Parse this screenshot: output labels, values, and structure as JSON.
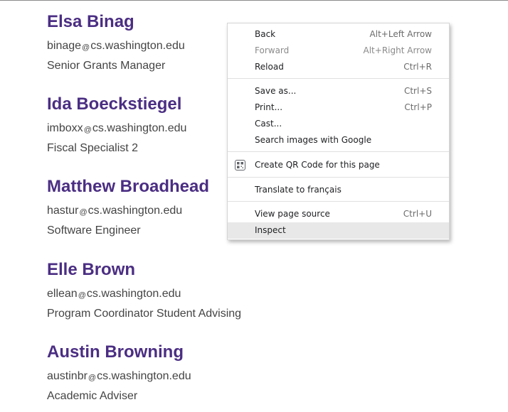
{
  "people": [
    {
      "name": "Elsa Binag",
      "email_user": "binage",
      "at": "@",
      "email_domain": "cs.washington.edu",
      "role": "Senior Grants Manager"
    },
    {
      "name": "Ida Boeckstiegel",
      "email_user": "imboxx",
      "at": "@",
      "email_domain": "cs.washington.edu",
      "role": "Fiscal Specialist 2"
    },
    {
      "name": "Matthew Broadhead",
      "email_user": "hastur",
      "at": "@",
      "email_domain": "cs.washington.edu",
      "role": "Software Engineer"
    },
    {
      "name": "Elle Brown",
      "email_user": "ellean",
      "at": "@",
      "email_domain": "cs.washington.edu",
      "role": "Program Coordinator Student Advising"
    },
    {
      "name": "Austin Browning",
      "email_user": "austinbr",
      "at": "@",
      "email_domain": "cs.washington.edu",
      "role": "Academic Adviser"
    }
  ],
  "context_menu": {
    "back": {
      "label": "Back",
      "shortcut": "Alt+Left Arrow"
    },
    "forward": {
      "label": "Forward",
      "shortcut": "Alt+Right Arrow"
    },
    "reload": {
      "label": "Reload",
      "shortcut": "Ctrl+R"
    },
    "save_as": {
      "label": "Save as...",
      "shortcut": "Ctrl+S"
    },
    "print": {
      "label": "Print...",
      "shortcut": "Ctrl+P"
    },
    "cast": {
      "label": "Cast..."
    },
    "search_images": {
      "label": "Search images with Google"
    },
    "qr_code": {
      "label": "Create QR Code for this page",
      "icon": "qr-code-icon"
    },
    "translate": {
      "label": "Translate to français"
    },
    "view_source": {
      "label": "View page source",
      "shortcut": "Ctrl+U"
    },
    "inspect": {
      "label": "Inspect"
    }
  },
  "colors": {
    "name_purple": "#4b2e83",
    "body_text": "#444444",
    "menu_hover": "#e8e8e8"
  }
}
